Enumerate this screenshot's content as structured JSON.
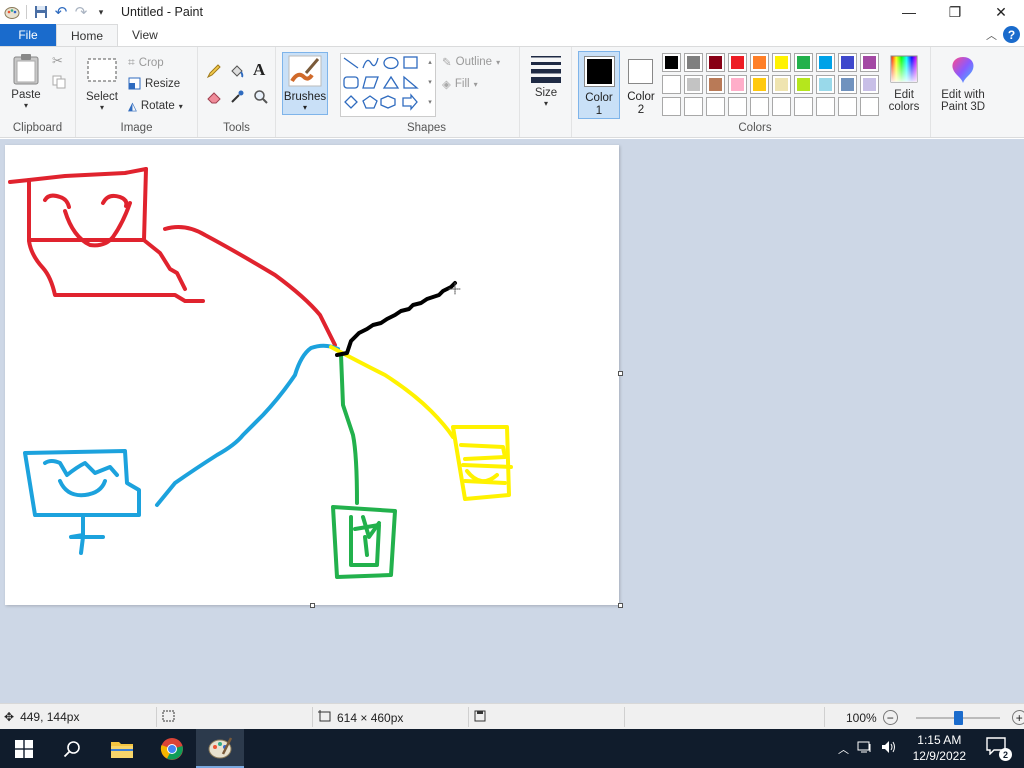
{
  "window": {
    "title": "Untitled - Paint"
  },
  "tabs": {
    "file": "File",
    "home": "Home",
    "view": "View"
  },
  "ribbon": {
    "clipboard": {
      "paste": "Paste",
      "label": "Clipboard"
    },
    "image": {
      "select": "Select",
      "crop": "Crop",
      "resize": "Resize",
      "rotate": "Rotate",
      "label": "Image"
    },
    "tools": {
      "label": "Tools"
    },
    "brushes": {
      "label": "Brushes"
    },
    "shapes": {
      "outline": "Outline",
      "fill": "Fill",
      "label": "Shapes"
    },
    "size": {
      "label": "Size"
    },
    "color1": {
      "label": "Color",
      "index": "1",
      "color": "#000000"
    },
    "color2": {
      "label": "Color",
      "index": "2",
      "color": "#ffffff"
    },
    "colors": {
      "label": "Colors",
      "palette_row1": [
        "#000000",
        "#7f7f7f",
        "#880015",
        "#ed1c24",
        "#ff7f27",
        "#fff200",
        "#22b14c",
        "#00a2e8",
        "#3f48cc",
        "#a349a4"
      ],
      "palette_row2": [
        "#ffffff",
        "#c3c3c3",
        "#b97a57",
        "#ffaec9",
        "#ffc90e",
        "#efe4b0",
        "#b5e61d",
        "#99d9ea",
        "#7092be",
        "#c8bfe7"
      ],
      "palette_row3": [
        "#ffffff",
        "#ffffff",
        "#ffffff",
        "#ffffff",
        "#ffffff",
        "#ffffff",
        "#ffffff",
        "#ffffff",
        "#ffffff",
        "#ffffff"
      ],
      "edit_colors_line1": "Edit",
      "edit_colors_line2": "colors"
    },
    "paint3d": {
      "line1": "Edit with",
      "line2": "Paint 3D"
    }
  },
  "drawing_colors": {
    "red": "#e0232e",
    "blue": "#1ca2dd",
    "green": "#22b14c",
    "yellow": "#fff200",
    "black": "#000000"
  },
  "status": {
    "cursor_pos": "449, 144px",
    "canvas_size": "614 × 460px",
    "zoom": "100%",
    "zoom_level": 1.0
  },
  "taskbar": {
    "time": "1:15 AM",
    "date": "12/9/2022",
    "notifications": "2"
  }
}
